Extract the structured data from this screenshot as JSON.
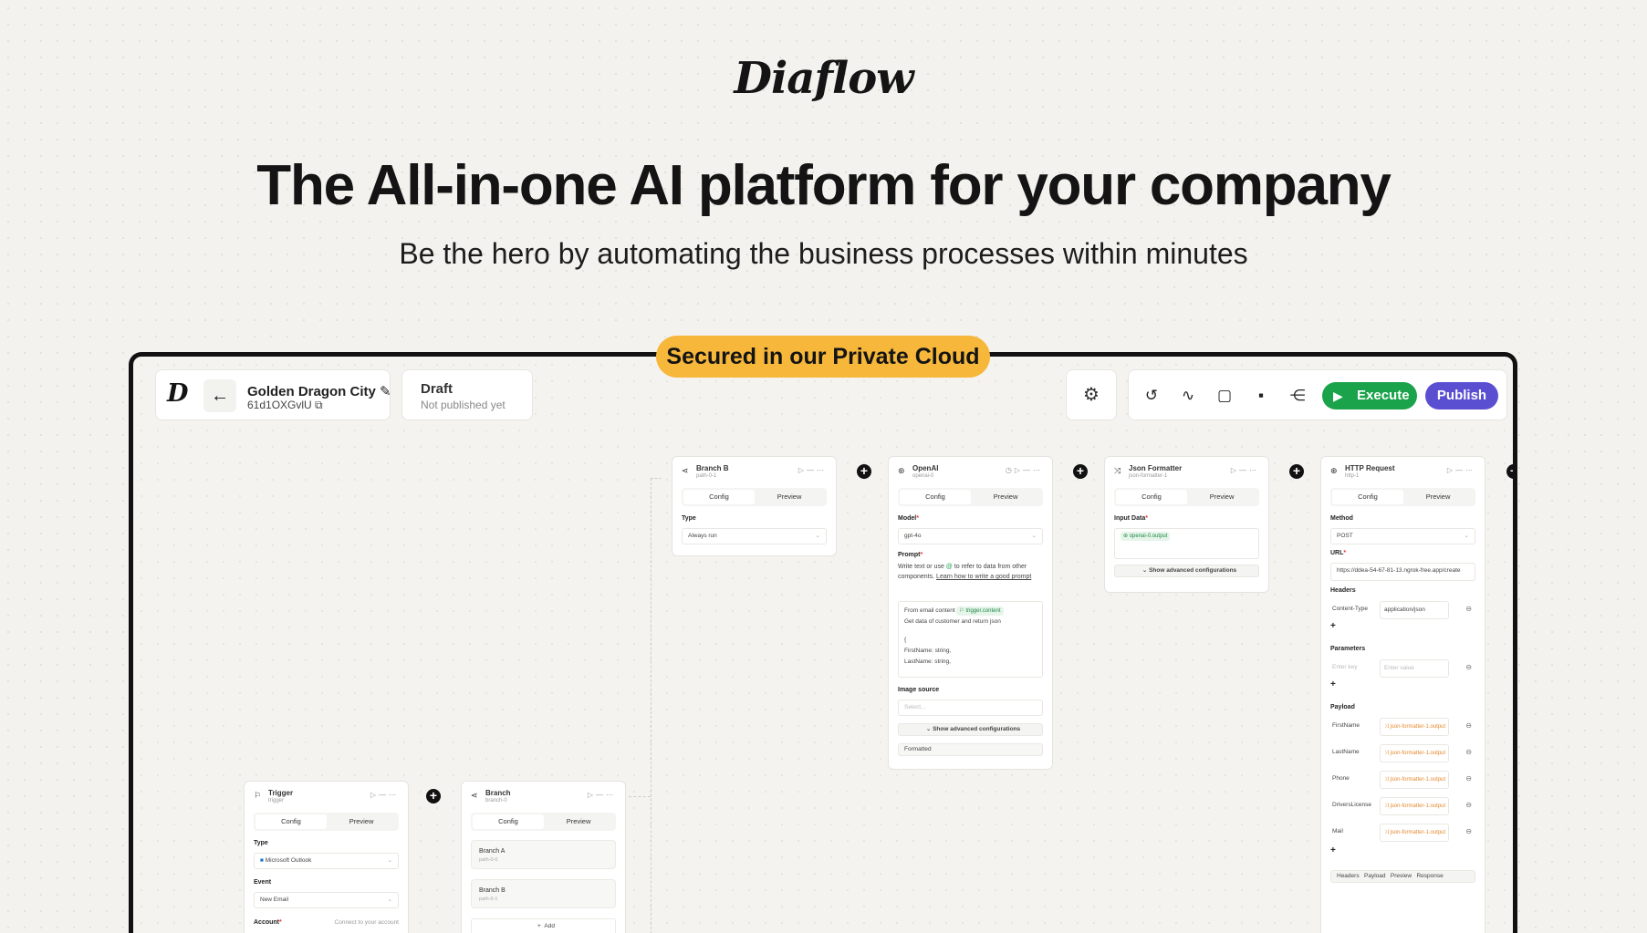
{
  "brand": {
    "logo": "Diaflow"
  },
  "hero": {
    "headline": "The All-in-one AI platform for your company",
    "subline": "Be the hero by automating the business processes within minutes",
    "badge": "Secured in our Private Cloud"
  },
  "colors": {
    "badge": "#f6b73a",
    "execute": "#1aa34a",
    "publish": "#5b4fd1"
  },
  "toolbar": {
    "project_name": "Golden Dragon City",
    "project_id": "61d1OXGvlU",
    "status_title": "Draft",
    "status_sub": "Not published yet",
    "execute_label": "Execute",
    "publish_label": "Publish"
  },
  "tabs": {
    "config": "Config",
    "preview": "Preview"
  },
  "nodes": {
    "trigger": {
      "title": "Trigger",
      "sub": "trigger",
      "type_label": "Type",
      "type_value": "Microsoft Outlook",
      "event_label": "Event",
      "event_value": "New Email",
      "account_label": "Account",
      "account_value": "Connect to your account"
    },
    "branch": {
      "title": "Branch",
      "sub": "branch-0",
      "items": [
        {
          "label": "Branch A",
          "sub": "path-0-0"
        },
        {
          "label": "Branch B",
          "sub": "path-0-1"
        }
      ],
      "add_label": "Add"
    },
    "branch_b": {
      "title": "Branch B",
      "sub": "path-0-1",
      "type_label": "Type",
      "type_value": "Always run"
    },
    "openai": {
      "title": "OpenAI",
      "sub": "openai-0",
      "model_label": "Model",
      "model_value": "gpt-4o",
      "prompt_label": "Prompt",
      "prompt_help_1": "Write text or use",
      "prompt_help_2": "to refer to data from other components.",
      "prompt_help_link": "Learn how to write a good prompt",
      "prompt_line1": "From email content",
      "prompt_tag": "trigger.content",
      "prompt_line2": "Get data of customer and return json",
      "prompt_line3": "{",
      "prompt_line4": "FirstName: string,",
      "prompt_line5": "LastName: string,",
      "image_label": "Image source",
      "image_placeholder": "Select...",
      "advanced": "Show advanced configurations",
      "formatted": "Formatted"
    },
    "json": {
      "title": "Json Formatter",
      "sub": "json-formatter-1",
      "input_label": "Input Data",
      "input_tag": "openai-0.output",
      "advanced": "Show advanced configurations"
    },
    "http": {
      "title": "HTTP Request",
      "sub": "http-1",
      "method_label": "Method",
      "method_value": "POST",
      "url_label": "URL",
      "url_value": "https://ddea-54-67-81-13.ngrok-free.app/create",
      "headers_label": "Headers",
      "header_key": "Content-Type",
      "header_value": "application/json",
      "params_label": "Parameters",
      "param_key_ph": "Enter key",
      "param_value_ph": "Enter value",
      "payload_label": "Payload",
      "payload": [
        {
          "key": "FirstName",
          "value": "json-formatter-1.output"
        },
        {
          "key": "LastName",
          "value": "json-formatter-1.output"
        },
        {
          "key": "Phone",
          "value": "json-formatter-1.output"
        },
        {
          "key": "DriversLicense",
          "value": "json-formatter-1.output"
        },
        {
          "key": "Mail",
          "value": "json-formatter-1.output"
        }
      ],
      "footer_tabs": [
        "Headers",
        "Payload",
        "Preview",
        "Response"
      ]
    }
  }
}
